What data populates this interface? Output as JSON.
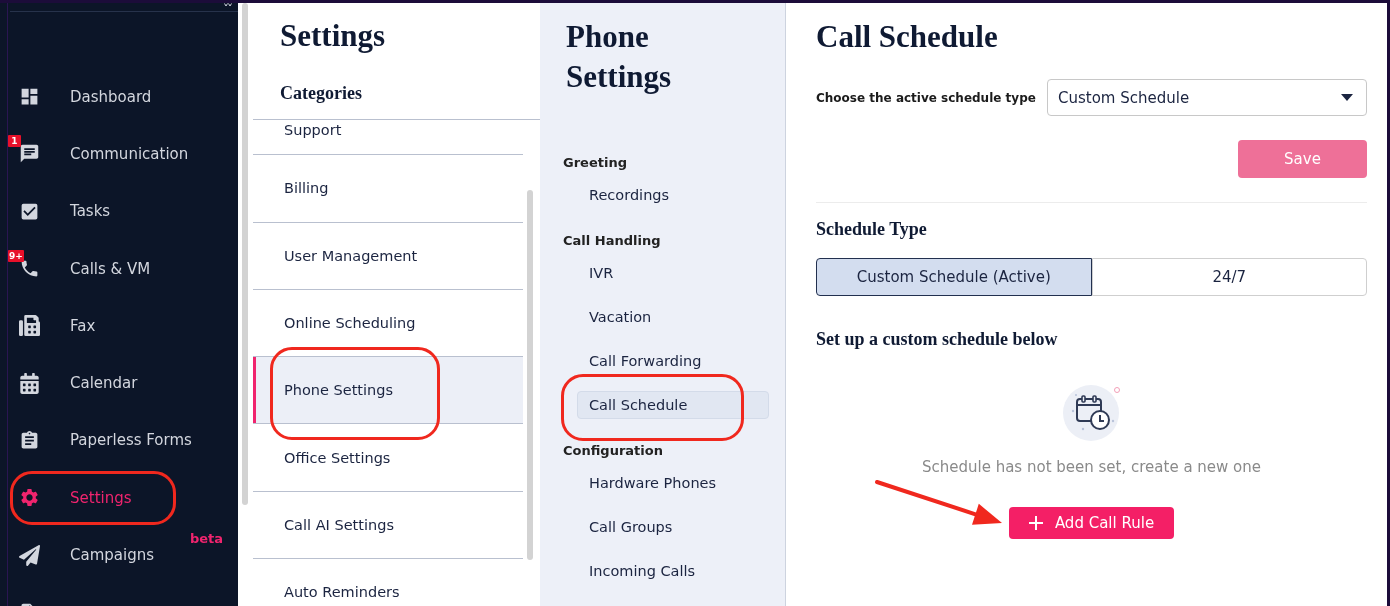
{
  "sidebar": {
    "items": [
      {
        "label": "Dashboard",
        "selected": false,
        "circled": false
      },
      {
        "label": "Communication",
        "badge": "1",
        "selected": false,
        "circled": false
      },
      {
        "label": "Tasks",
        "selected": false,
        "circled": false
      },
      {
        "label": "Calls & VM",
        "badge": "9+",
        "selected": false,
        "circled": false
      },
      {
        "label": "Fax",
        "selected": false,
        "circled": false
      },
      {
        "label": "Calendar",
        "selected": false,
        "circled": false
      },
      {
        "label": "Paperless Forms",
        "selected": false,
        "circled": false
      },
      {
        "label": "Settings",
        "selected": true,
        "circled": true
      },
      {
        "label": "Campaigns",
        "tag": "beta",
        "selected": false,
        "circled": false
      }
    ]
  },
  "settings_panel": {
    "title": "Settings",
    "categories_heading": "Categories",
    "categories": [
      {
        "label": "Support",
        "selected": false,
        "circled": false
      },
      {
        "label": "Billing",
        "selected": false,
        "circled": false
      },
      {
        "label": "User Management",
        "selected": false,
        "circled": false
      },
      {
        "label": "Online Scheduling",
        "selected": false,
        "circled": false
      },
      {
        "label": "Phone Settings",
        "selected": true,
        "circled": true
      },
      {
        "label": "Office Settings",
        "selected": false,
        "circled": false
      },
      {
        "label": "Call AI Settings",
        "selected": false,
        "circled": false
      },
      {
        "label": "Auto Reminders",
        "selected": false,
        "circled": false
      }
    ]
  },
  "phone_settings": {
    "title": "Phone Settings",
    "groups": [
      {
        "heading": "Greeting",
        "items": [
          {
            "label": "Recordings",
            "selected": false,
            "circled": false
          }
        ]
      },
      {
        "heading": "Call Handling",
        "items": [
          {
            "label": "IVR",
            "selected": false,
            "circled": false
          },
          {
            "label": "Vacation",
            "selected": false,
            "circled": false
          },
          {
            "label": "Call Forwarding",
            "selected": false,
            "circled": false
          },
          {
            "label": "Call Schedule",
            "selected": true,
            "circled": true
          }
        ]
      },
      {
        "heading": "Configuration",
        "items": [
          {
            "label": "Hardware Phones",
            "selected": false,
            "circled": false
          },
          {
            "label": "Call Groups",
            "selected": false,
            "circled": false
          },
          {
            "label": "Incoming Calls",
            "selected": false,
            "circled": false
          }
        ]
      }
    ]
  },
  "call_schedule": {
    "title": "Call Schedule",
    "active_type": {
      "label": "Choose the active schedule type",
      "value": "Custom Schedule"
    },
    "save_button": {
      "label": "Save",
      "disabled": true
    },
    "schedule_type": {
      "heading": "Schedule Type",
      "options": [
        {
          "label": "Custom Schedule (Active)",
          "selected": true
        },
        {
          "label": "24/7",
          "selected": false
        }
      ]
    },
    "custom_section": {
      "heading": "Set up a custom schedule below",
      "empty_message": "Schedule has not been set, create a new one",
      "add_button": {
        "label": "Add Call Rule",
        "arrow": true
      }
    }
  }
}
